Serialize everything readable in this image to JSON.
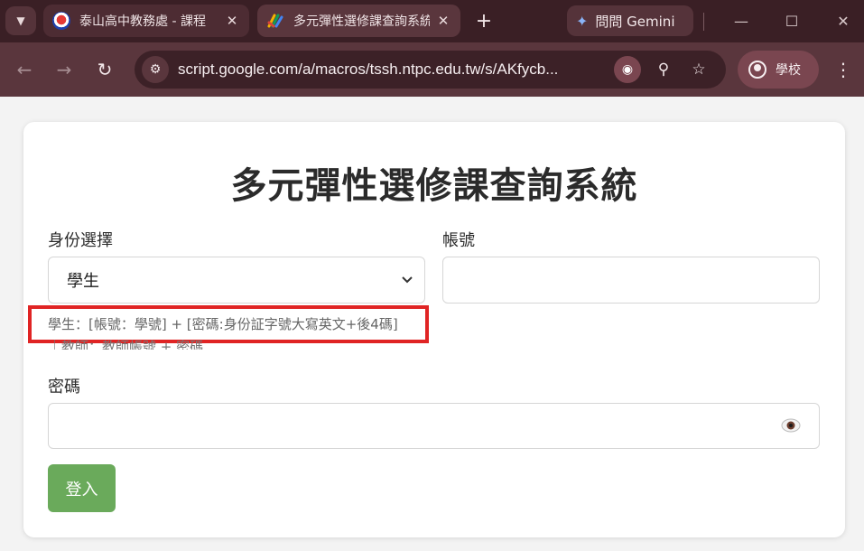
{
  "browser": {
    "tabs": [
      {
        "title": "泰山高中教務處 - 課程",
        "close": "✕"
      },
      {
        "title": "多元彈性選修課查詢系統",
        "close": "✕"
      }
    ],
    "new_tab": "+",
    "gemini_label": "問問 Gemini",
    "url": "script.google.com/a/macros/tssh.ntpc.edu.tw/s/AKfycb...",
    "profile_label": "學校"
  },
  "page": {
    "title": "多元彈性選修課查詢系統",
    "identity_label": "身份選擇",
    "identity_selected": "學生",
    "account_label": "帳號",
    "account_value": "",
    "hint_student": "學生：[帳號：學號] + [密碼:身份証字號大寫英文+後4碼]",
    "hint_teacher": "｜教師：教師帳號 + 密碼",
    "password_label": "密碼",
    "password_value": "",
    "login_label": "登入"
  },
  "colors": {
    "highlight_border": "#e02424",
    "login_button": "#6aaa5b",
    "browser_frame": "#5a363d"
  }
}
